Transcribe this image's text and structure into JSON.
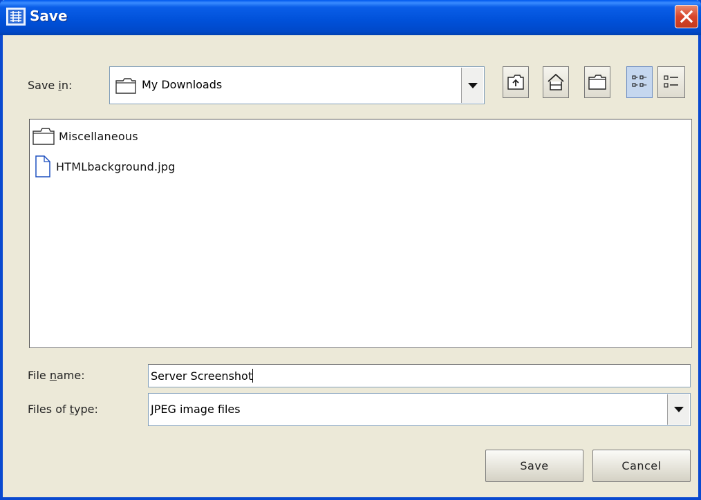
{
  "window": {
    "title": "Save"
  },
  "save_in": {
    "label_pre": "Save ",
    "label_mnemonic": "i",
    "label_post": "n:",
    "selected": "My Downloads"
  },
  "toolbar": {
    "icons": [
      "up-one-level-icon",
      "home-icon",
      "new-folder-icon",
      "list-view-icon",
      "details-view-icon"
    ]
  },
  "files": [
    {
      "name": "Miscellaneous",
      "icon": "folder-icon"
    },
    {
      "name": "HTMLbackground.jpg",
      "icon": "file-icon"
    }
  ],
  "file_name": {
    "label_pre": "File ",
    "label_mnemonic": "n",
    "label_post": "ame:",
    "value": "Server Screenshot"
  },
  "file_type": {
    "label_pre": "Files of ",
    "label_mnemonic": "t",
    "label_post": "ype:",
    "selected": "JPEG image files"
  },
  "buttons": {
    "save": "Save",
    "cancel": "Cancel"
  },
  "colors": {
    "titlebar": "#0054e3",
    "dialog_bg": "#ece9d8",
    "close_button": "#d8452a"
  }
}
